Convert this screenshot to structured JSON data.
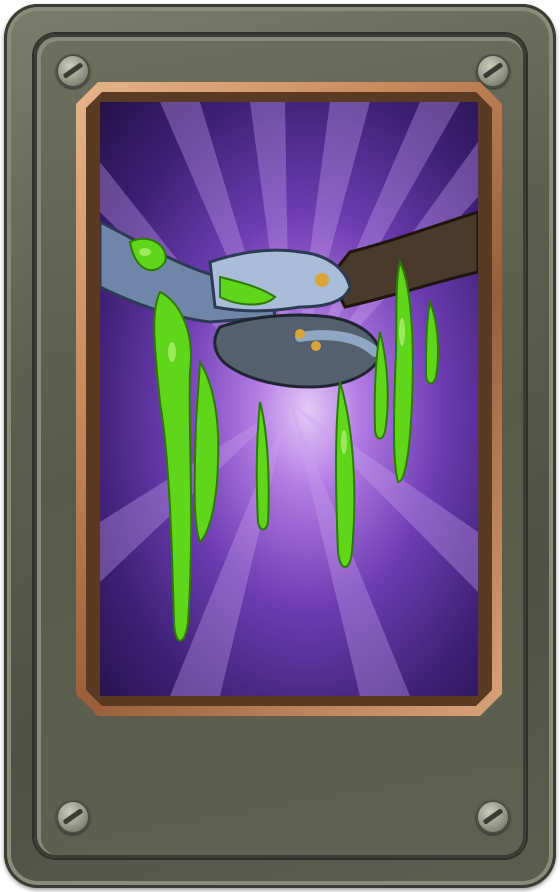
{
  "card": {
    "art_subject": "handshake-slime-art",
    "colors": {
      "frame_metal": "#5d5f51",
      "bezel_copper": "#c98a5c",
      "background_purple": "#6e3db2",
      "slime_green": "#5fd61a"
    }
  }
}
